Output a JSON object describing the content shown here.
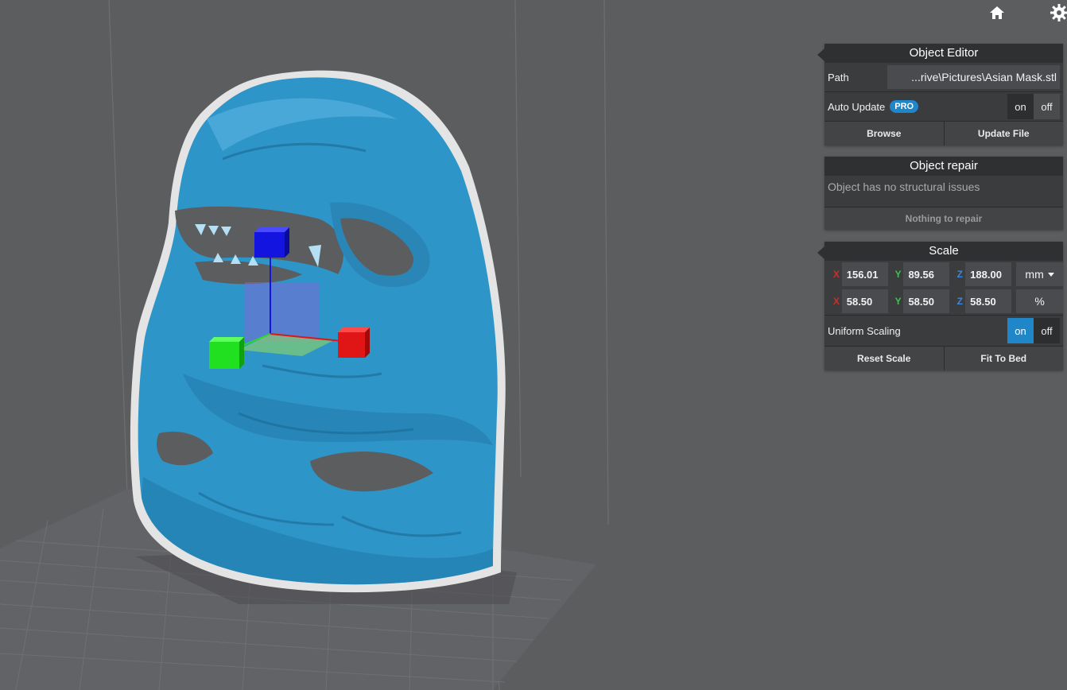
{
  "colors": {
    "background": "#5c5d5f",
    "model": "#2e95c9",
    "accent": "#1f86c9",
    "axis_x": "#e01515",
    "axis_y": "#20e020",
    "axis_z": "#1414e0"
  },
  "toolbar": {
    "home_icon": "home-icon",
    "settings_icon": "gear-icon"
  },
  "object_editor": {
    "title": "Object Editor",
    "path_label": "Path",
    "path_value": "...rive\\Pictures\\Asian Mask.stl",
    "auto_update_label": "Auto Update",
    "pro_badge": "PRO",
    "toggle_on": "on",
    "toggle_off": "off",
    "auto_update_state": "off",
    "browse_label": "Browse",
    "update_file_label": "Update File"
  },
  "object_repair": {
    "title": "Object repair",
    "status": "Object has no structural issues",
    "action_label": "Nothing to repair"
  },
  "scale": {
    "title": "Scale",
    "x_label": "X",
    "y_label": "Y",
    "z_label": "Z",
    "size_x": "156.01",
    "size_y": "89.56",
    "size_z": "188.00",
    "size_unit": "mm",
    "pct_x": "58.50",
    "pct_y": "58.50",
    "pct_z": "58.50",
    "pct_unit": "%",
    "uniform_label": "Uniform Scaling",
    "toggle_on": "on",
    "toggle_off": "off",
    "uniform_state": "on",
    "reset_label": "Reset Scale",
    "fit_label": "Fit To Bed"
  }
}
